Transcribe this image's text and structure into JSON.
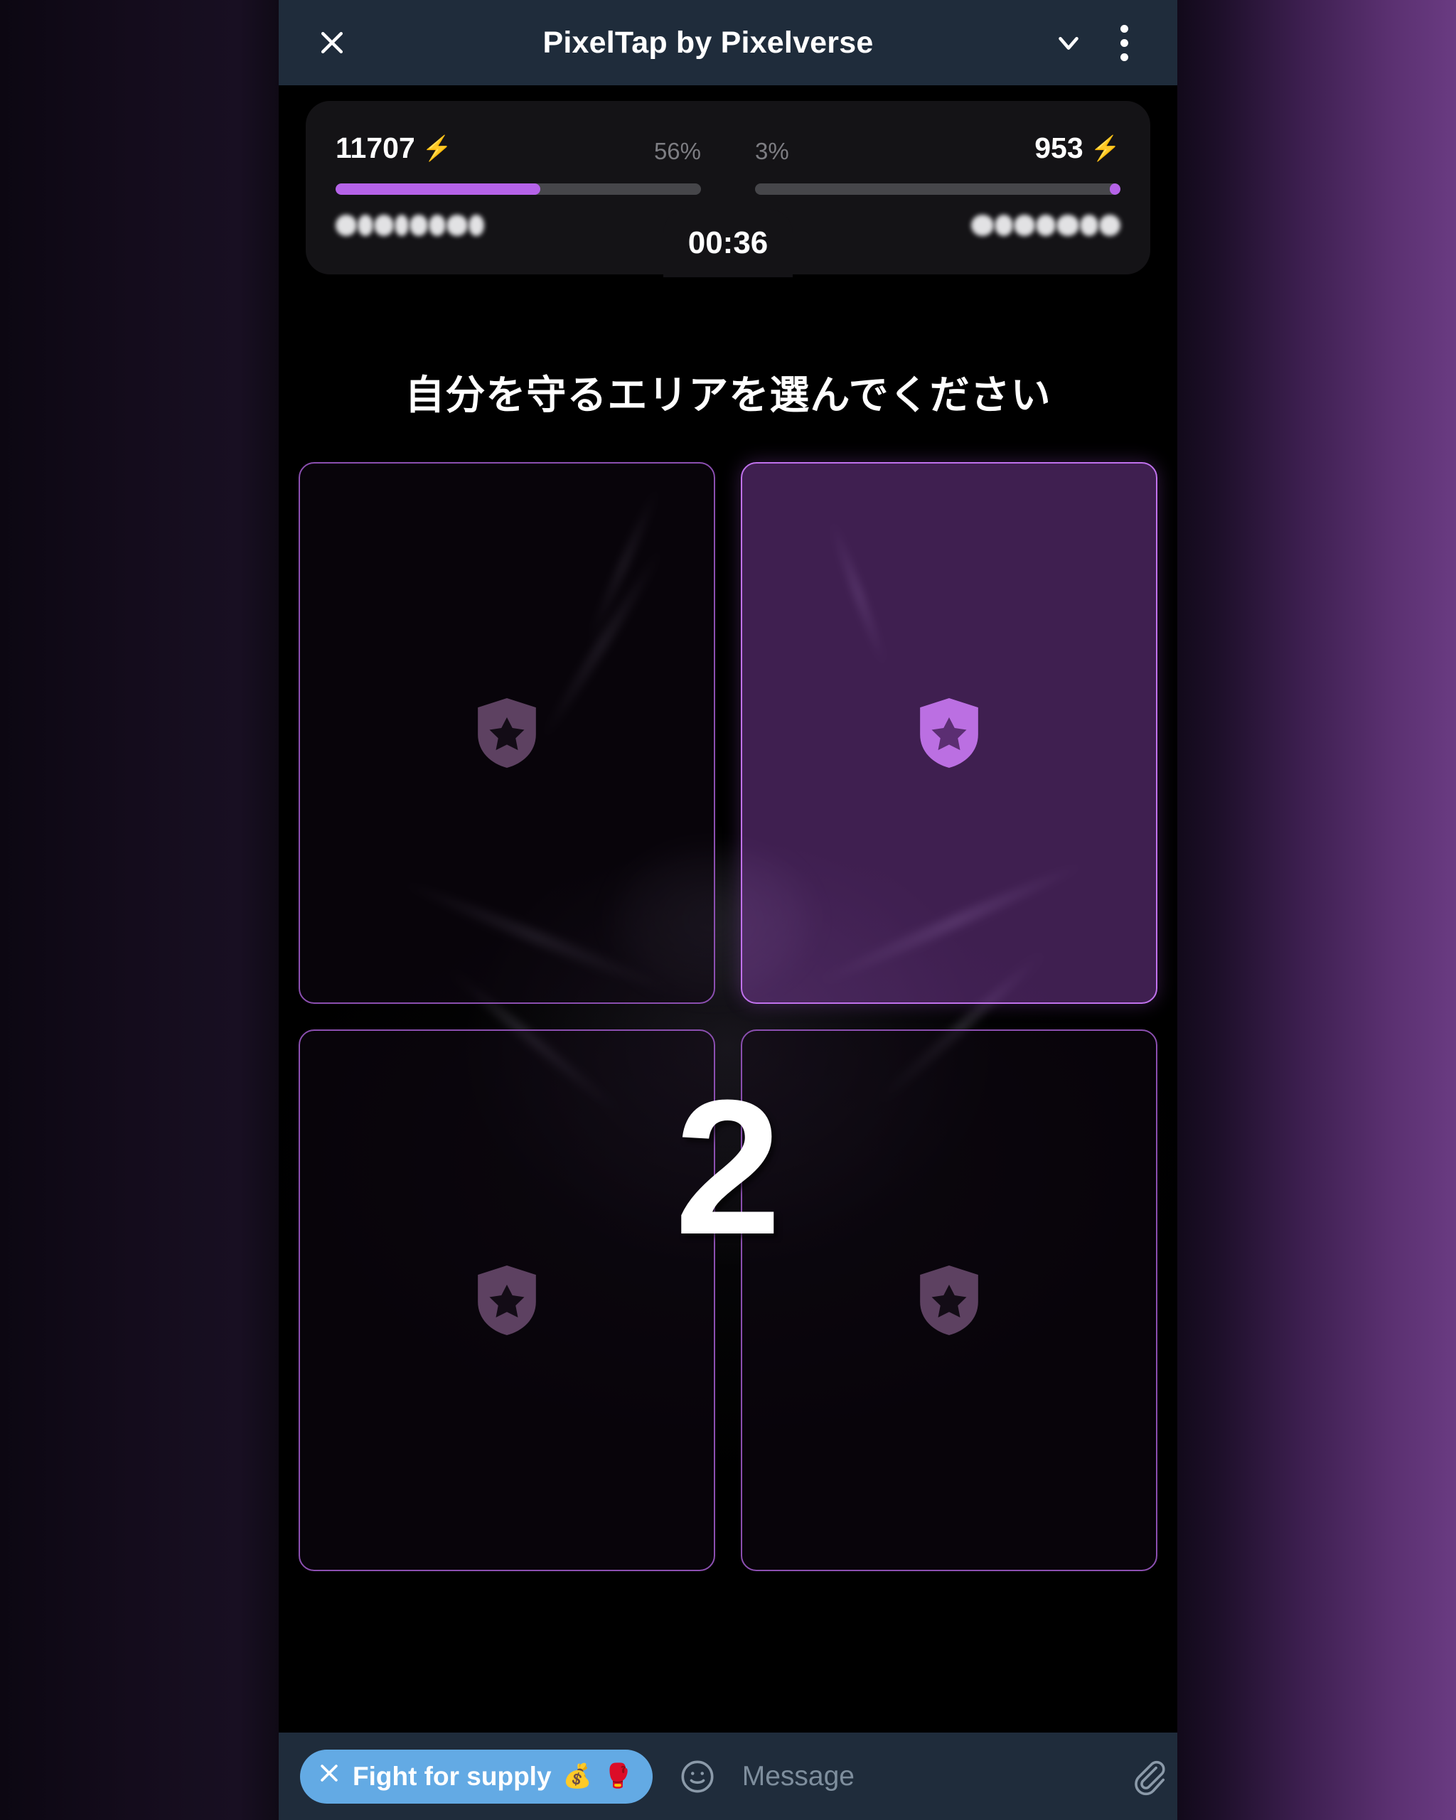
{
  "app": {
    "background_color": "#0a0610",
    "glow_color": "#6a3b82",
    "accent_purple": "#b563e8",
    "header_bg": "#1f2c3b"
  },
  "header": {
    "title": "PixelTap by Pixelverse",
    "close_icon": "close-icon",
    "collapse_icon": "chevron-down-icon",
    "menu_icon": "kebab-menu-icon"
  },
  "stats": {
    "timer": "00:36",
    "left_player": {
      "score": "11707",
      "energy_icon": "⚡",
      "percent": "56%",
      "fill_ratio": 56,
      "name_hidden": true,
      "name_blur_blocks": 8
    },
    "right_player": {
      "score": "953",
      "energy_icon": "⚡",
      "percent": "3%",
      "fill_ratio": 3,
      "name_hidden": true,
      "name_blur_blocks": 7
    }
  },
  "game": {
    "heading": "自分を守るエリアを選んでください",
    "countdown": "2",
    "cells": [
      {
        "id": "top-left",
        "selected": false,
        "icon": "shield-star-icon"
      },
      {
        "id": "top-right",
        "selected": true,
        "icon": "shield-star-icon"
      },
      {
        "id": "bottom-left",
        "selected": false,
        "icon": "shield-star-icon"
      },
      {
        "id": "bottom-right",
        "selected": false,
        "icon": "shield-star-icon"
      }
    ]
  },
  "composer": {
    "supply_chip": {
      "close_icon": "close-icon",
      "label": "Fight for supply",
      "emoji_money": "💰",
      "emoji_glove": "🥊"
    },
    "emoji_icon": "smiley-icon",
    "message_placeholder": "Message",
    "message_value": "",
    "attach_icon": "paperclip-icon",
    "mic_icon": "microphone-icon"
  }
}
